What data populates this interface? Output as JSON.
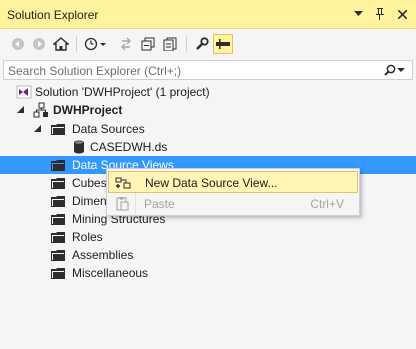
{
  "window": {
    "title": "Solution Explorer"
  },
  "search": {
    "placeholder": "Search Solution Explorer (Ctrl+;)"
  },
  "tree": {
    "solution": "Solution 'DWHProject' (1 project)",
    "project": "DWHProject",
    "items": {
      "data_sources": "Data Sources",
      "casedwh": "CASEDWH.ds",
      "data_source_views": "Data Source Views",
      "cubes": "Cubes",
      "dimensions": "Dimensions",
      "mining_structures": "Mining Structures",
      "roles": "Roles",
      "assemblies": "Assemblies",
      "miscellaneous": "Miscellaneous"
    }
  },
  "context_menu": {
    "new_dsv": "New Data Source View...",
    "paste": "Paste",
    "paste_shortcut": "Ctrl+V"
  },
  "colors": {
    "accent": "#fff39d",
    "selection": "#3399ff",
    "folder": "#2d2d30"
  }
}
